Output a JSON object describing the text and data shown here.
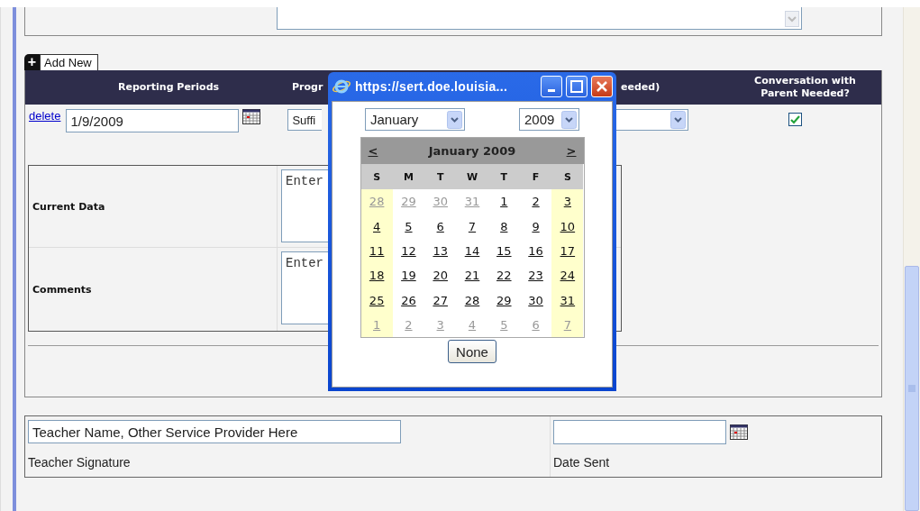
{
  "add_new": {
    "icon": "+",
    "label": "Add New"
  },
  "table": {
    "columns": [
      "Reporting Periods",
      "Progr",
      "eeded)",
      "Conversation with Parent Needed?"
    ],
    "row": {
      "delete": "delete",
      "date": "1/9/2009",
      "progress": "Suffi",
      "parent_conversation": {
        "checked": true
      }
    }
  },
  "details": [
    {
      "label": "Current Data",
      "value": "Enter"
    },
    {
      "label": "Comments",
      "value": "Enter"
    }
  ],
  "popup": {
    "title": "https://sert.doe.louisia...",
    "month": "January",
    "year": "2009",
    "calendar": {
      "prev": "<",
      "next": ">",
      "heading": "January 2009",
      "weekdays": [
        "S",
        "M",
        "T",
        "W",
        "T",
        "F",
        "S"
      ],
      "weeks": [
        [
          {
            "day": "28",
            "other": true
          },
          {
            "day": "29",
            "other": true
          },
          {
            "day": "30",
            "other": true
          },
          {
            "day": "31",
            "other": true
          },
          {
            "day": "1",
            "other": false
          },
          {
            "day": "2",
            "other": false
          },
          {
            "day": "3",
            "other": false
          }
        ],
        [
          {
            "day": "4",
            "other": false
          },
          {
            "day": "5",
            "other": false
          },
          {
            "day": "6",
            "other": false
          },
          {
            "day": "7",
            "other": false
          },
          {
            "day": "8",
            "other": false
          },
          {
            "day": "9",
            "other": false
          },
          {
            "day": "10",
            "other": false
          }
        ],
        [
          {
            "day": "11",
            "other": false
          },
          {
            "day": "12",
            "other": false
          },
          {
            "day": "13",
            "other": false
          },
          {
            "day": "14",
            "other": false
          },
          {
            "day": "15",
            "other": false
          },
          {
            "day": "16",
            "other": false
          },
          {
            "day": "17",
            "other": false
          }
        ],
        [
          {
            "day": "18",
            "other": false
          },
          {
            "day": "19",
            "other": false
          },
          {
            "day": "20",
            "other": false
          },
          {
            "day": "21",
            "other": false
          },
          {
            "day": "22",
            "other": false
          },
          {
            "day": "23",
            "other": false
          },
          {
            "day": "24",
            "other": false
          }
        ],
        [
          {
            "day": "25",
            "other": false
          },
          {
            "day": "26",
            "other": false
          },
          {
            "day": "27",
            "other": false
          },
          {
            "day": "28",
            "other": false
          },
          {
            "day": "29",
            "other": false
          },
          {
            "day": "30",
            "other": false
          },
          {
            "day": "31",
            "other": false
          }
        ],
        [
          {
            "day": "1",
            "other": true
          },
          {
            "day": "2",
            "other": true
          },
          {
            "day": "3",
            "other": true
          },
          {
            "day": "4",
            "other": true
          },
          {
            "day": "5",
            "other": true
          },
          {
            "day": "6",
            "other": true
          },
          {
            "day": "7",
            "other": true
          }
        ]
      ]
    },
    "none_button": "None"
  },
  "signature": {
    "name_value": "Teacher Name, Other Service Provider Here",
    "name_label": "Teacher Signature",
    "date_label": "Date Sent"
  }
}
